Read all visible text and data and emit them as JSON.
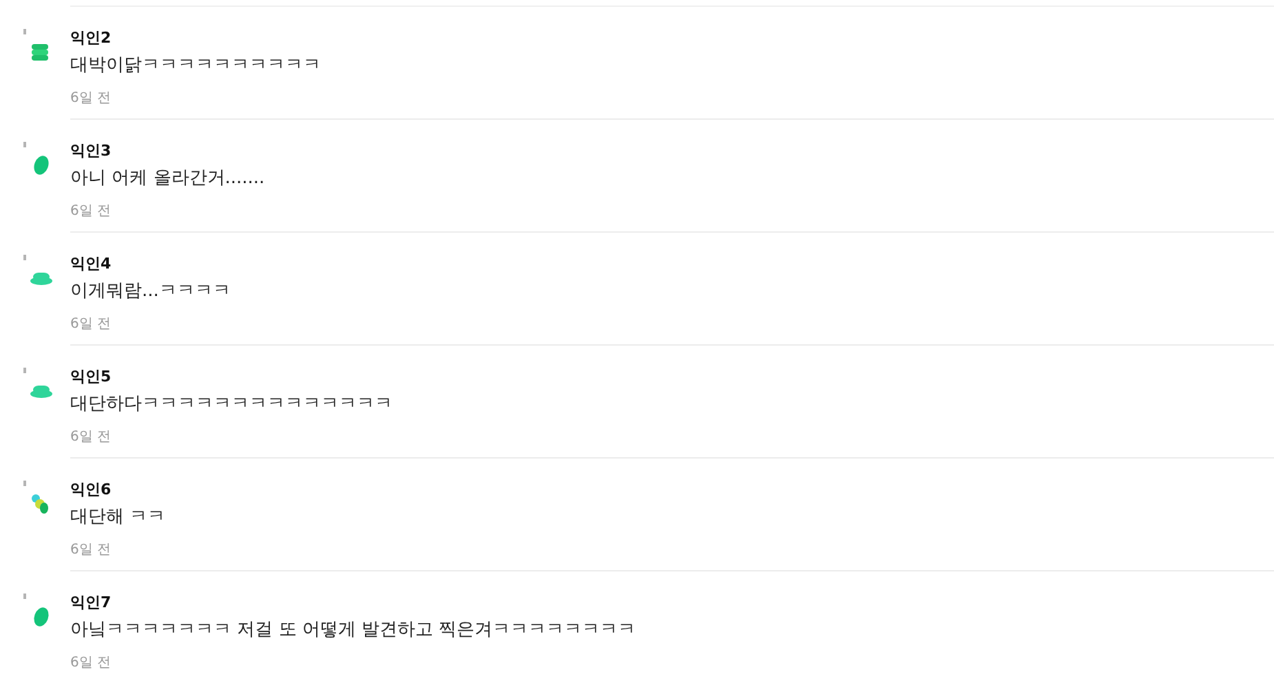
{
  "comments": [
    {
      "author": "익인2",
      "text": "대박이닭ㅋㅋㅋㅋㅋㅋㅋㅋㅋㅋ",
      "time": "6일 전",
      "avatar": {
        "kind": "stack"
      }
    },
    {
      "author": "익인3",
      "text": "아니 어케 올라간거.......",
      "time": "6일 전",
      "avatar": {
        "kind": "pill"
      }
    },
    {
      "author": "익인4",
      "text": "이게뭐람...ㅋㅋㅋㅋ",
      "time": "6일 전",
      "avatar": {
        "kind": "hat"
      }
    },
    {
      "author": "익인5",
      "text": "대단하다ㅋㅋㅋㅋㅋㅋㅋㅋㅋㅋㅋㅋㅋㅋ",
      "time": "6일 전",
      "avatar": {
        "kind": "hat"
      }
    },
    {
      "author": "익인6",
      "text": "대단해 ㅋㅋ",
      "time": "6일 전",
      "avatar": {
        "kind": "dots"
      }
    },
    {
      "author": "익인7",
      "text": "아닠ㅋㅋㅋㅋㅋㅋㅋ 저걸 또 어떻게 발견하고 찍은겨ㅋㅋㅋㅋㅋㅋㅋㅋ",
      "time": "6일 전",
      "avatar": {
        "kind": "pill"
      }
    }
  ]
}
